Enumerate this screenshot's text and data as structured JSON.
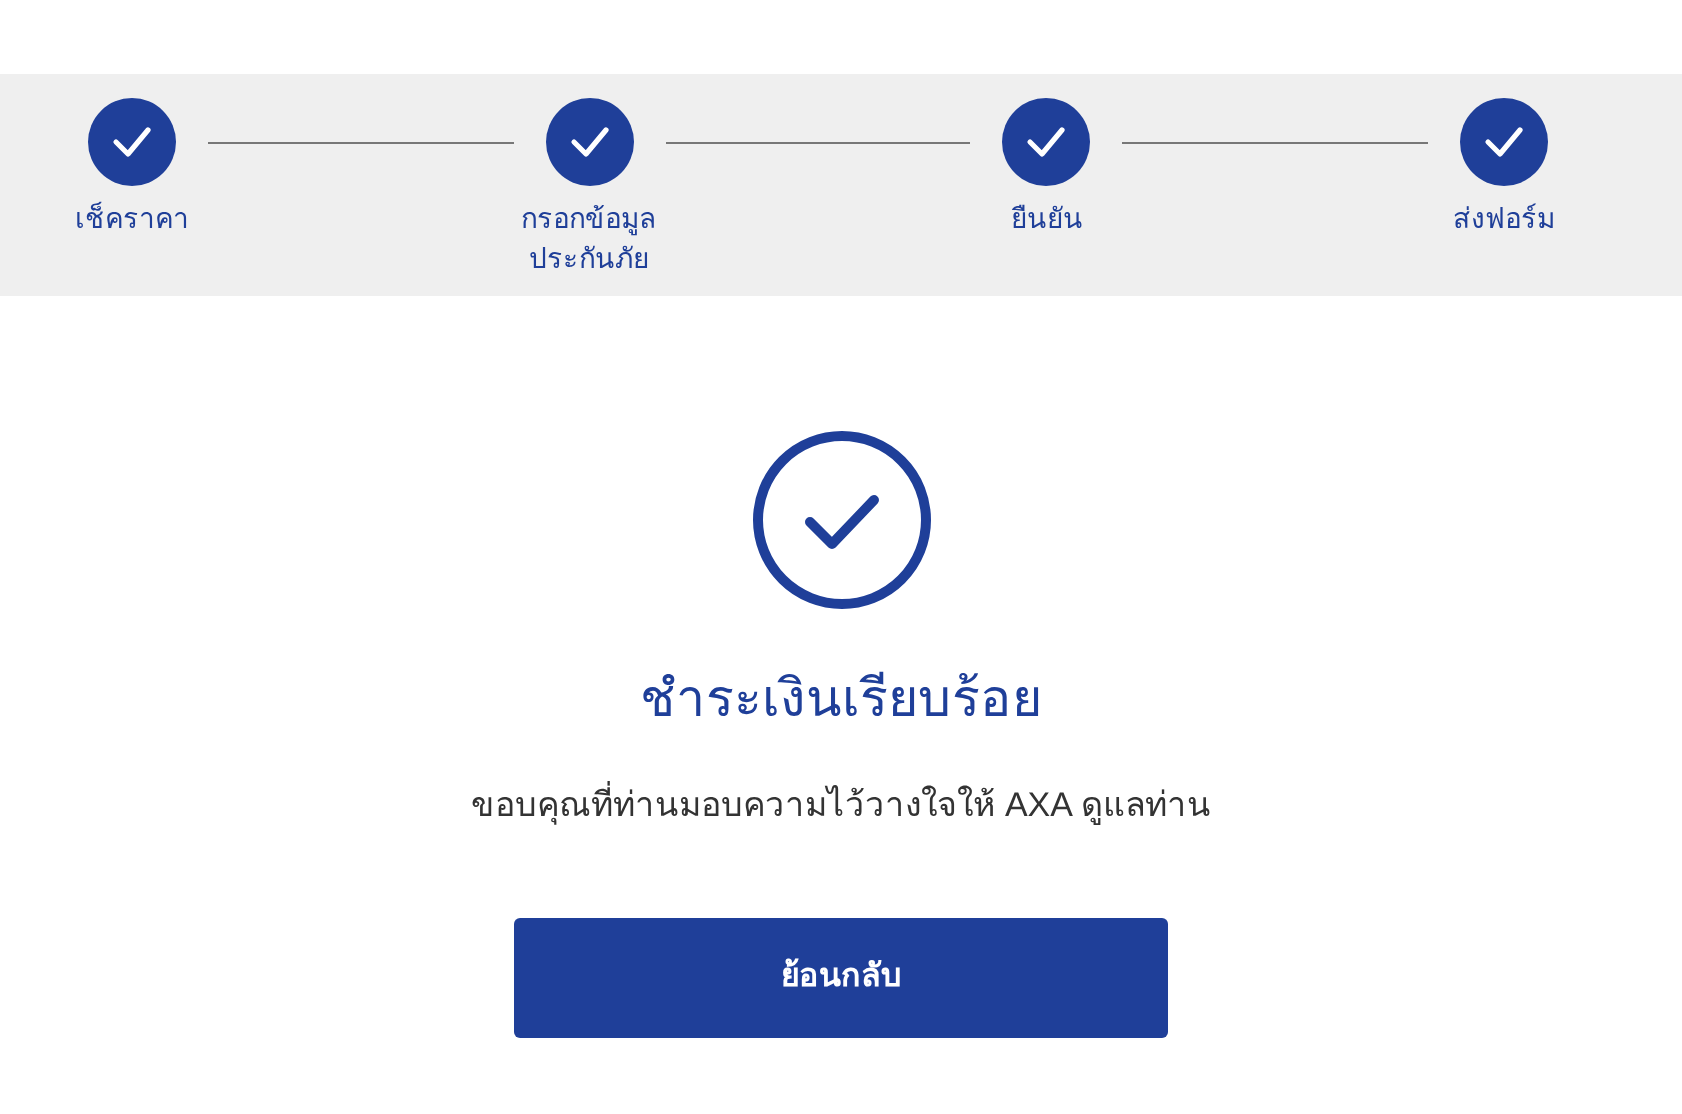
{
  "steps": [
    {
      "label": "เช็คราคา",
      "completed": true
    },
    {
      "label": "กรอกข้อมูล ประกันภัย",
      "completed": true
    },
    {
      "label": "ยืนยัน",
      "completed": true
    },
    {
      "label": "ส่งฟอร์ม",
      "completed": true
    }
  ],
  "result": {
    "title": "ชำระเงินเรียบร้อย",
    "message": "ขอบคุณที่ท่านมอบความไว้วางใจให้ AXA ดูแลท่าน"
  },
  "button": {
    "label": "ย้อนกลับ"
  }
}
